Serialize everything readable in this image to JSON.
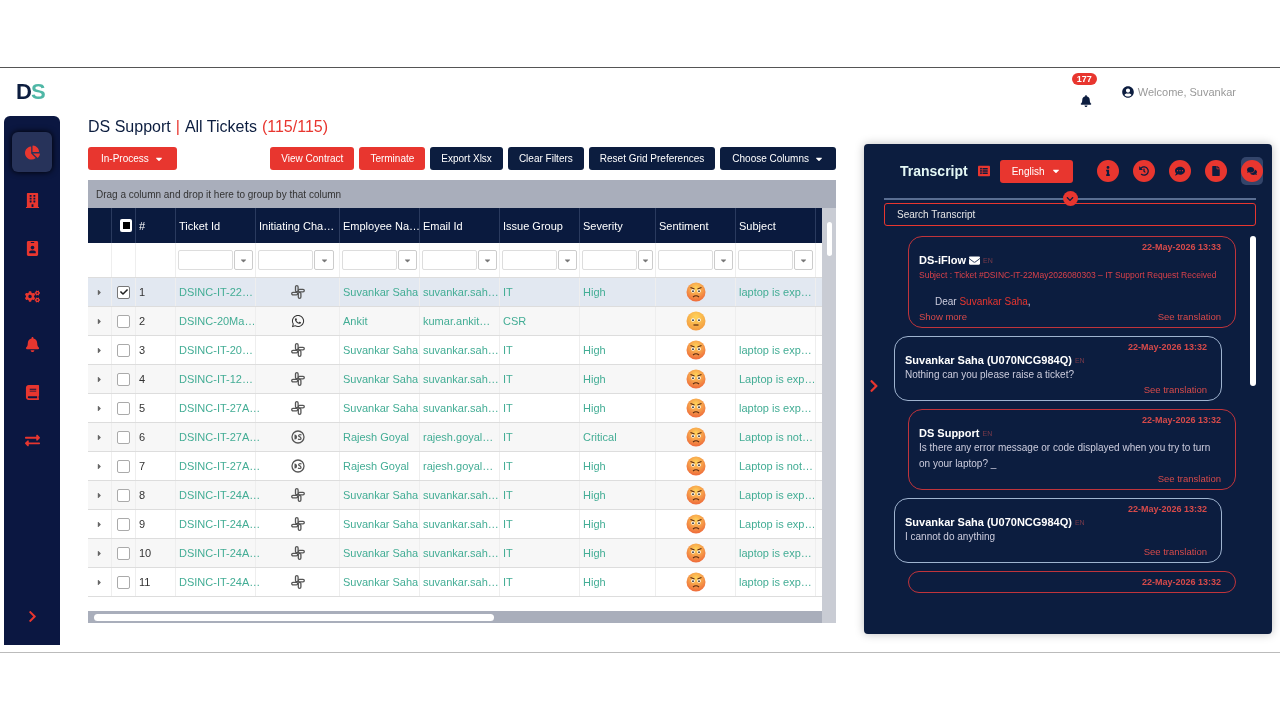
{
  "logo": {
    "first": "D",
    "second": "S"
  },
  "header": {
    "notifications": "177",
    "welcome": "Welcome, Suvankar"
  },
  "sidebar": {
    "items": [
      {
        "kind": "chart",
        "selected": true
      },
      {
        "kind": "building",
        "selected": false
      },
      {
        "kind": "badge",
        "selected": false
      },
      {
        "kind": "gears",
        "selected": false
      },
      {
        "kind": "bell",
        "selected": false
      },
      {
        "kind": "book",
        "selected": false
      },
      {
        "kind": "exchange",
        "selected": false
      }
    ]
  },
  "page": {
    "app": "DS Support",
    "separator": "|",
    "view": "All Tickets",
    "count": "(115/115)"
  },
  "toolbar": {
    "status_filter": "In-Process",
    "buttons": [
      {
        "label": "View Contract",
        "kind": "danger"
      },
      {
        "label": "Terminate",
        "kind": "danger"
      },
      {
        "label": "Export Xlsx",
        "kind": "dark"
      },
      {
        "label": "Clear Filters",
        "kind": "dark"
      },
      {
        "label": "Reset Grid Preferences",
        "kind": "dark"
      }
    ],
    "columns_menu": "Choose Columns"
  },
  "grid": {
    "group_hint": "Drag a column and drop it here to group by that column",
    "select_all_partial": true,
    "columns": [
      {
        "label": "#",
        "filter": false
      },
      {
        "label": "Ticket Id",
        "filter": true
      },
      {
        "label": "Initiating Cha…",
        "filter": true
      },
      {
        "label": "Employee Na…",
        "filter": true
      },
      {
        "label": "Email Id",
        "filter": true
      },
      {
        "label": "Issue Group",
        "filter": true
      },
      {
        "label": "Severity",
        "filter": true
      },
      {
        "label": "Sentiment",
        "filter": true
      },
      {
        "label": "Subject",
        "filter": true
      }
    ],
    "rows": [
      {
        "selected": true,
        "number": "1",
        "ticket_id": "DSINC-IT-22…",
        "channel": {
          "kind": "slack"
        },
        "employee": "Suvankar Saha",
        "email": "suvankar.sah…",
        "issue_group": "IT",
        "severity": "High",
        "sentiment": {
          "kind": "angry"
        },
        "subject": "laptop is exp…"
      },
      {
        "selected": false,
        "number": "2",
        "ticket_id": "DSINC-20Ma…",
        "channel": {
          "kind": "whatsapp"
        },
        "employee": "Ankit",
        "email": "kumar.ankit…",
        "issue_group": "CSR",
        "sentiment": {
          "kind": "neutral"
        }
      },
      {
        "selected": false,
        "number": "3",
        "ticket_id": "DSINC-IT-20…",
        "channel": {
          "kind": "slack"
        },
        "employee": "Suvankar Saha",
        "email": "suvankar.sah…",
        "issue_group": "IT",
        "severity": "High",
        "sentiment": {
          "kind": "angry"
        },
        "subject": "laptop is exp…"
      },
      {
        "selected": false,
        "number": "4",
        "ticket_id": "DSINC-IT-12…",
        "channel": {
          "kind": "slack"
        },
        "employee": "Suvankar Saha",
        "email": "suvankar.sah…",
        "issue_group": "IT",
        "severity": "High",
        "sentiment": {
          "kind": "angry"
        },
        "subject": "Laptop is exp…"
      },
      {
        "selected": false,
        "number": "5",
        "ticket_id": "DSINC-IT-27A…",
        "channel": {
          "kind": "slack"
        },
        "employee": "Suvankar Saha",
        "email": "suvankar.sah…",
        "issue_group": "IT",
        "severity": "High",
        "sentiment": {
          "kind": "angry"
        },
        "subject": "laptop is exp…"
      },
      {
        "selected": false,
        "number": "6",
        "ticket_id": "DSINC-IT-27A…",
        "channel": {
          "kind": "portal"
        },
        "employee": "Rajesh Goyal",
        "email": "rajesh.goyal…",
        "issue_group": "IT",
        "severity": "Critical",
        "sentiment": {
          "kind": "angry"
        },
        "subject": "Laptop is not…"
      },
      {
        "selected": false,
        "number": "7",
        "ticket_id": "DSINC-IT-27A…",
        "channel": {
          "kind": "portal"
        },
        "employee": "Rajesh Goyal",
        "email": "rajesh.goyal…",
        "issue_group": "IT",
        "severity": "High",
        "sentiment": {
          "kind": "angry"
        },
        "subject": "Laptop is not…"
      },
      {
        "selected": false,
        "number": "8",
        "ticket_id": "DSINC-IT-24A…",
        "channel": {
          "kind": "slack"
        },
        "employee": "Suvankar Saha",
        "email": "suvankar.sah…",
        "issue_group": "IT",
        "severity": "High",
        "sentiment": {
          "kind": "angry"
        },
        "subject": "Laptop is exp…"
      },
      {
        "selected": false,
        "number": "9",
        "ticket_id": "DSINC-IT-24A…",
        "channel": {
          "kind": "slack"
        },
        "employee": "Suvankar Saha",
        "email": "suvankar.sah…",
        "issue_group": "IT",
        "severity": "High",
        "sentiment": {
          "kind": "angry"
        },
        "subject": "Laptop is exp…"
      },
      {
        "selected": false,
        "number": "10",
        "ticket_id": "DSINC-IT-24A…",
        "channel": {
          "kind": "slack"
        },
        "employee": "Suvankar Saha",
        "email": "suvankar.sah…",
        "issue_group": "IT",
        "severity": "High",
        "sentiment": {
          "kind": "angry"
        },
        "subject": "laptop is exp…"
      },
      {
        "selected": false,
        "number": "11",
        "ticket_id": "DSINC-IT-24A…",
        "channel": {
          "kind": "slack"
        },
        "employee": "Suvankar Saha",
        "email": "suvankar.sah…",
        "issue_group": "IT",
        "severity": "High",
        "sentiment": {
          "kind": "angry"
        },
        "subject": "laptop is exp…"
      }
    ]
  },
  "transcript": {
    "title": "Transcript",
    "language": "English",
    "actions": [
      {
        "kind": "info",
        "selected": false
      },
      {
        "kind": "history",
        "selected": false
      },
      {
        "kind": "comment",
        "selected": false
      },
      {
        "kind": "file",
        "selected": false
      },
      {
        "kind": "comments",
        "selected": true
      }
    ],
    "search_placeholder": "Search Transcript",
    "messages": [
      {
        "kind": "bot",
        "time": "22-May-2026 13:33",
        "sender": "DS-iFlow",
        "email": true,
        "lang": "EN",
        "subject": "Subject : Ticket #DSINC-IT-22May2026080303 – IT Support Request Received",
        "body": "Dear **Suvankar Saha**,",
        "show_more": "Show more",
        "translation": "See translation"
      },
      {
        "kind": "user",
        "time": "22-May-2026 13:32",
        "sender": "Suvankar Saha (U070NCG984Q)",
        "lang": "EN",
        "body": "Nothing can you please raise a ticket?",
        "translation": "See translation"
      },
      {
        "kind": "bot",
        "time": "22-May-2026 13:32",
        "sender": "DS Support",
        "lang": "EN",
        "body": "Is there any error message or code displayed when you try to turn on your laptop? _",
        "translation": "See translation"
      },
      {
        "kind": "user",
        "time": "22-May-2026 13:32",
        "sender": "Suvankar Saha (U070NCG984Q)",
        "lang": "EN",
        "body": "I cannot do anything",
        "translation": "See translation"
      },
      {
        "kind": "bot",
        "time": "22-May-2026 13:32"
      }
    ]
  }
}
